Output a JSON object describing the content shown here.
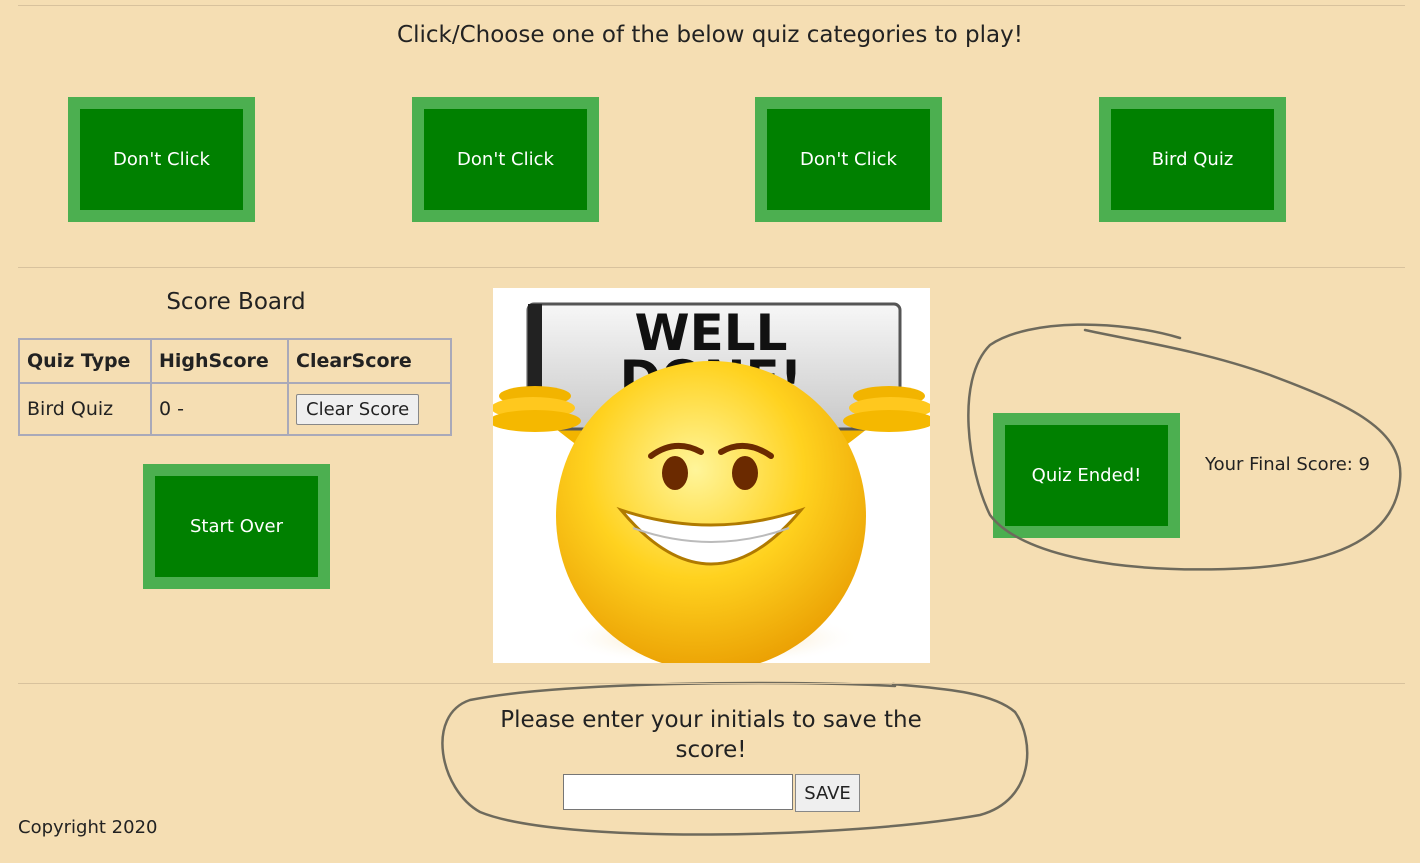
{
  "heading": "Click/Choose one of the below quiz categories to play!",
  "categories": [
    {
      "label": "Don't Click"
    },
    {
      "label": "Don't Click"
    },
    {
      "label": "Don't Click"
    },
    {
      "label": "Bird Quiz"
    }
  ],
  "scoreboard": {
    "title": "Score Board",
    "columns": [
      "Quiz Type",
      "HighScore",
      "ClearScore"
    ],
    "rows": [
      {
        "quiz_type": "Bird Quiz",
        "high_score": "0 -",
        "clear_label": "Clear Score"
      }
    ],
    "start_over_label": "Start Over"
  },
  "well_done_image": {
    "sign_line1": "WELL",
    "sign_line2": "DONE!"
  },
  "result": {
    "quiz_ended_label": "Quiz Ended!",
    "final_score_text": "Your Final Score: 9"
  },
  "save": {
    "prompt": "Please enter your initials to save the score!",
    "input_value": "",
    "input_placeholder": "",
    "save_label": "SAVE"
  },
  "footer": {
    "copyright": "Copyright 2020"
  },
  "colors": {
    "page_background": "#f5deb3",
    "button_green": "#008000",
    "button_border": "#4caf50"
  }
}
